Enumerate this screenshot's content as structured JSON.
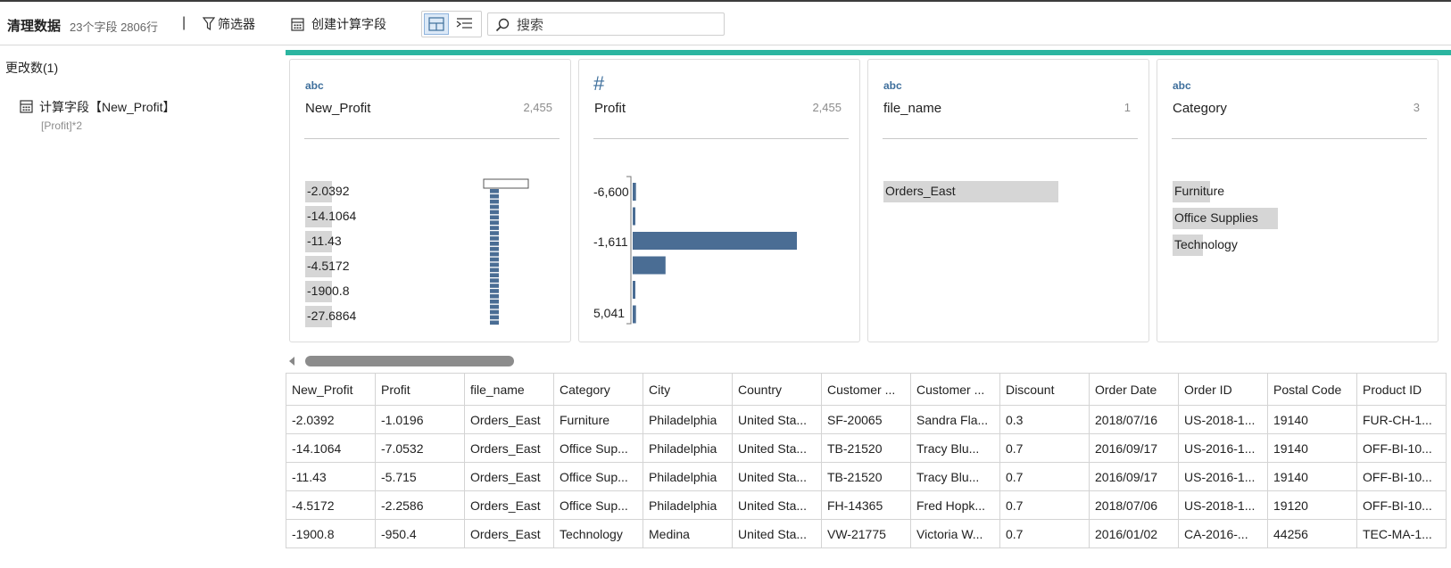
{
  "toolbar": {
    "title": "清理数据",
    "meta": "23个字段  2806行",
    "separator": "|",
    "filter_label": "筛选器",
    "create_calc_label": "创建计算字段",
    "search_placeholder": "搜索"
  },
  "changes": {
    "title": "更改数(1)",
    "items": [
      {
        "label": "计算字段【New_Profit】",
        "expr": "[Profit]*2",
        "icon": "calculation-icon"
      }
    ]
  },
  "accent_color": "#2bb5a0",
  "bar_color": "#4a6d94",
  "cards": [
    {
      "type_label": "abc",
      "name": "New_Profit",
      "count": "2,455",
      "values": [
        "-2.0392",
        "-14.1064",
        "-11.43",
        "-4.5172",
        "-1900.8",
        "-27.6864"
      ],
      "value_fill": 0.1
    },
    {
      "type_label": "#",
      "name": "Profit",
      "count": "2,455",
      "bins": [
        "-6,600",
        "-1,611",
        "5,041"
      ],
      "hist": [
        2,
        1,
        100,
        20,
        1,
        2
      ]
    },
    {
      "type_label": "abc",
      "name": "file_name",
      "count": "1",
      "values": [
        "Orders_East"
      ],
      "value_fill": 1.0
    },
    {
      "type_label": "abc",
      "name": "Category",
      "count": "3",
      "values": [
        "Furniture",
        "Office Supplies",
        "Technology"
      ],
      "value_fill_list": [
        0.35,
        1.0,
        0.29
      ]
    }
  ],
  "table": {
    "columns": [
      "New_Profit",
      "Profit",
      "file_name",
      "Category",
      "City",
      "Country",
      "Customer ...",
      "Customer ...",
      "Discount",
      "Order Date",
      "Order ID",
      "Postal Code",
      "Product ID"
    ],
    "rows": [
      [
        "-2.0392",
        "-1.0196",
        "Orders_East",
        "Furniture",
        "Philadelphia",
        "United Sta...",
        "SF-20065",
        "Sandra Fla...",
        "0.3",
        "2018/07/16",
        "US-2018-1...",
        "19140",
        "FUR-CH-1..."
      ],
      [
        "-14.1064",
        "-7.0532",
        "Orders_East",
        "Office Sup...",
        "Philadelphia",
        "United Sta...",
        "TB-21520",
        "Tracy Blu...",
        "0.7",
        "2016/09/17",
        "US-2016-1...",
        "19140",
        "OFF-BI-10..."
      ],
      [
        "-11.43",
        "-5.715",
        "Orders_East",
        "Office Sup...",
        "Philadelphia",
        "United Sta...",
        "TB-21520",
        "Tracy Blu...",
        "0.7",
        "2016/09/17",
        "US-2016-1...",
        "19140",
        "OFF-BI-10..."
      ],
      [
        "-4.5172",
        "-2.2586",
        "Orders_East",
        "Office Sup...",
        "Philadelphia",
        "United Sta...",
        "FH-14365",
        "Fred Hopk...",
        "0.7",
        "2018/07/06",
        "US-2018-1...",
        "19120",
        "OFF-BI-10..."
      ],
      [
        "-1900.8",
        "-950.4",
        "Orders_East",
        "Technology",
        "Medina",
        "United Sta...",
        "VW-21775",
        "Victoria W...",
        "0.7",
        "2016/01/02",
        "CA-2016-...",
        "44256",
        "TEC-MA-1..."
      ]
    ]
  }
}
